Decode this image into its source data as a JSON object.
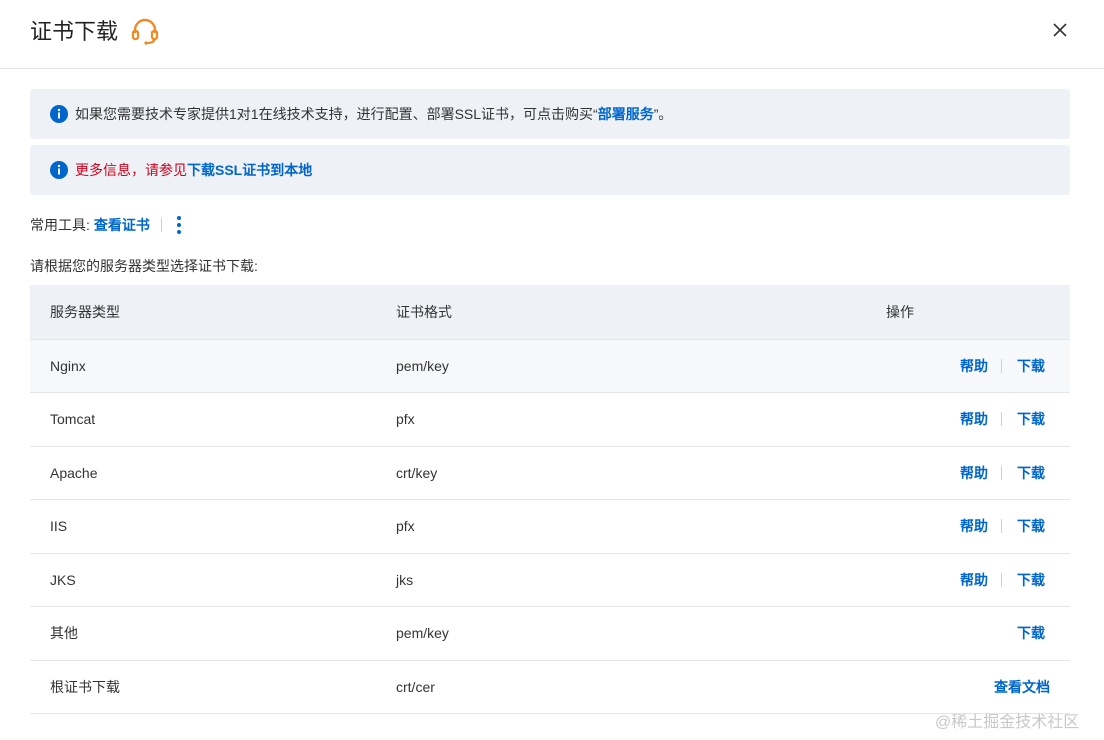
{
  "header": {
    "title": "证书下载",
    "close_label": "×"
  },
  "notices": [
    {
      "text": "如果您需要技术专家提供1对1在线技术支持，进行配置、部署SSL证书，可点击购买“",
      "link": "部署服务",
      "suffix": "”。"
    },
    {
      "text": "更多信息，请参见",
      "link": "下载SSL证书到本地"
    }
  ],
  "tools": {
    "label": "常用工具:",
    "link": "查看证书"
  },
  "hint": "请根据您的服务器类型选择证书下载:",
  "table": {
    "headers": [
      "服务器类型",
      "证书格式",
      "操作"
    ],
    "rows": [
      {
        "server": "Nginx",
        "format": "pem/key",
        "help": "帮助",
        "download": "下载"
      },
      {
        "server": "Tomcat",
        "format": "pfx",
        "help": "帮助",
        "download": "下载"
      },
      {
        "server": "Apache",
        "format": "crt/key",
        "help": "帮助",
        "download": "下载"
      },
      {
        "server": "IIS",
        "format": "pfx",
        "help": "帮助",
        "download": "下载"
      },
      {
        "server": "JKS",
        "format": "jks",
        "help": "帮助",
        "download": "下载"
      },
      {
        "server": "其他",
        "format": "pem/key",
        "download": "下载"
      },
      {
        "server": "根证书下载",
        "format": "crt/cer",
        "doc": "查看文档"
      }
    ]
  },
  "watermark": "@稀土掘金技术社区",
  "colors": {
    "link": "#0066cc",
    "warning_text": "#d0021b",
    "notice_bg": "#eef2f7",
    "accent_icon": "#f08a24"
  }
}
